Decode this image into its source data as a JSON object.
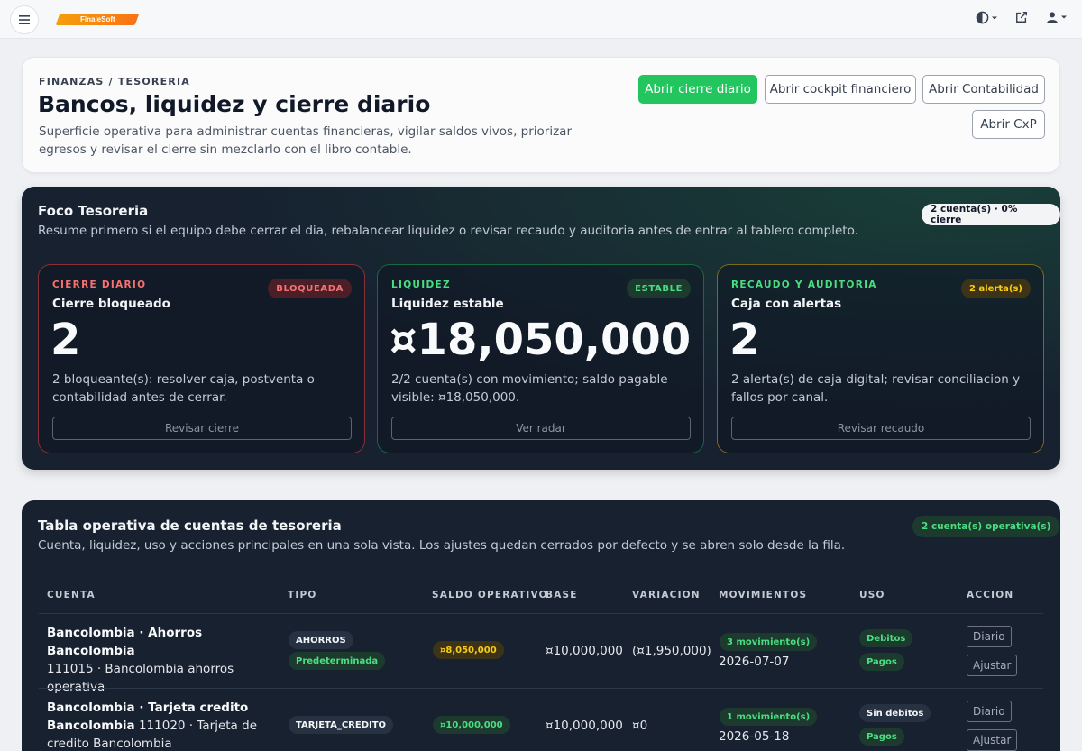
{
  "topbar": {
    "logo_text": "FinaleSoft",
    "icons": [
      "menu-icon",
      "contrast-icon",
      "external-link-icon",
      "user-icon"
    ]
  },
  "header": {
    "breadcrumb": "FINANZAS / TESORERIA",
    "title": "Bancos, liquidez y cierre diario",
    "description": "Superficie operativa para administrar cuentas financieras, vigilar saldos vivos, priorizar egresos y revisar el cierre sin mezclarlo con el libro contable.",
    "buttons": {
      "cierre": "Abrir cierre diario",
      "cockpit": "Abrir cockpit financiero",
      "contabilidad": "Abrir Contabilidad",
      "cxp": "Abrir CxP"
    }
  },
  "focus": {
    "title": "Foco Tesoreria",
    "description": "Resume primero si el equipo debe cerrar el dia, rebalancear liquidez o revisar recaudo y auditoria antes de entrar al tablero completo.",
    "summary_pill": "2 cuenta(s) · 0% cierre",
    "cards": [
      {
        "kicker": "CIERRE DIARIO",
        "badge": "BLOQUEADA",
        "title": "Cierre bloqueado",
        "value": "2",
        "description": "2 bloqueante(s): resolver caja, postventa o contabilidad antes de cerrar.",
        "button": "Revisar cierre"
      },
      {
        "kicker": "LIQUIDEZ",
        "badge": "ESTABLE",
        "title": "Liquidez estable",
        "value": "¤18,050,000",
        "description": "2/2 cuenta(s) con movimiento; saldo pagable visible: ¤18,050,000.",
        "button": "Ver radar"
      },
      {
        "kicker": "RECAUDO Y AUDITORIA",
        "badge": "2 alerta(s)",
        "title": "Caja con alertas",
        "value": "2",
        "description": "2 alerta(s) de caja digital; revisar conciliacion y fallos por canal.",
        "button": "Revisar recaudo"
      }
    ],
    "colors": {
      "red": "#ef4444",
      "green": "#22c55e",
      "amber": "#eab308"
    }
  },
  "accounts": {
    "title": "Tabla operativa de cuentas de tesoreria",
    "description": "Cuenta, liquidez, uso y acciones principales en una sola vista. Los ajustes quedan cerrados por defecto y se abren solo desde la fila.",
    "summary_pill": "2 cuenta(s) operativa(s)",
    "columns": [
      "CUENTA",
      "TIPO",
      "SALDO OPERATIVO",
      "BASE",
      "VARIACION",
      "MOVIMIENTOS",
      "USO",
      "ACCION"
    ],
    "rows": [
      {
        "name": "Bancolombia · Ahorros Bancolombia",
        "name_rest": "",
        "detail": "111015 · Bancolombia ahorros operativa",
        "type": "AHORROS",
        "type_extra": "Predeterminada",
        "balance": "¤8,050,000",
        "base": "¤10,000,000",
        "variation": "(¤1,950,000)",
        "movements": "3 movimiento(s)",
        "date": "2026-07-07",
        "uso": [
          "Debitos",
          "Pagos"
        ],
        "actions": [
          "Diario",
          "Ajustar"
        ]
      },
      {
        "name": "Bancolombia · Tarjeta credito",
        "name_rest": "Bancolombia",
        "detail": "111020 · Tarjeta de credito Bancolombia",
        "type": "TARJETA_CREDITO",
        "type_extra": "",
        "balance": "¤10,000,000",
        "base": "¤10,000,000",
        "variation": "¤0",
        "movements": "1 movimiento(s)",
        "date": "2026-05-18",
        "uso": [
          "Sin debitos",
          "Pagos"
        ],
        "actions": [
          "Diario",
          "Ajustar"
        ]
      }
    ]
  }
}
